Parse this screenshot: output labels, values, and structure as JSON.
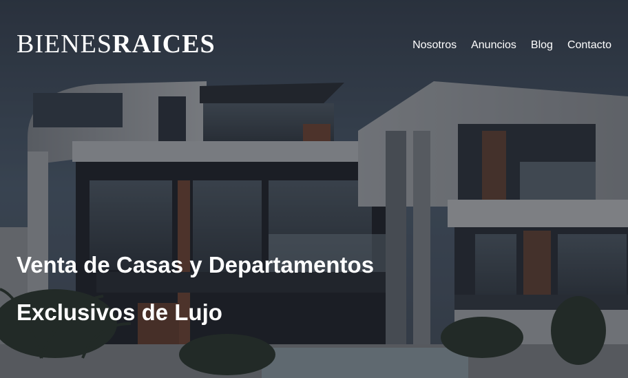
{
  "header": {
    "logo_light": "BIENES",
    "logo_bold": "RAICES",
    "nav": [
      {
        "label": "Nosotros"
      },
      {
        "label": "Anuncios"
      },
      {
        "label": "Blog"
      },
      {
        "label": "Contacto"
      }
    ]
  },
  "hero": {
    "headline_line1": "Venta de Casas y Departamentos",
    "headline_line2": "Exclusivos de Lujo",
    "background_image": "modern-luxury-house-photo"
  },
  "colors": {
    "text": "#ffffff",
    "overlay": "rgba(22,24,32,0.45)",
    "sky": "#4a5868"
  }
}
